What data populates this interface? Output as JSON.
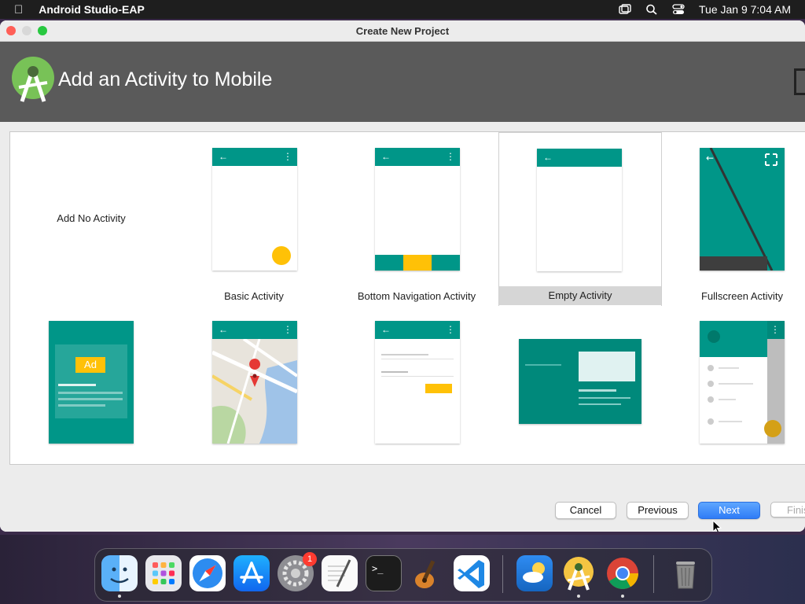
{
  "menubar": {
    "app_name": "Android Studio-EAP",
    "clock": "Tue Jan 9  7:04 AM",
    "icons": [
      "apple-icon",
      "window-icon",
      "search-icon",
      "control-center-icon"
    ]
  },
  "window": {
    "title": "Create New Project",
    "header_title": "Add an Activity to Mobile"
  },
  "gallery": {
    "row1": [
      {
        "label": "Add No Activity"
      },
      {
        "label": "Basic Activity"
      },
      {
        "label": "Bottom Navigation Activity"
      },
      {
        "label": "Empty Activity",
        "selected": true
      },
      {
        "label": "Fullscreen Activity"
      }
    ],
    "ad_badge": "Ad",
    "map_template_icons": [
      "back-arrow-icon",
      "overflow-menu-icon",
      "map-pin-icon"
    ]
  },
  "footer": {
    "cancel": "Cancel",
    "previous": "Previous",
    "next": "Next",
    "finish": "Finish"
  },
  "dock": {
    "badge_count": "1",
    "apps": [
      "finder",
      "launchpad",
      "safari",
      "app-store",
      "system-settings",
      "textedit",
      "terminal",
      "garageband",
      "vscode",
      "weather",
      "android-studio",
      "chrome",
      "trash"
    ]
  },
  "colors": {
    "teal": "#009688",
    "accent_yellow": "#ffc107",
    "header_gray": "#5a5a5a",
    "primary_button": "#2f7cf6"
  }
}
